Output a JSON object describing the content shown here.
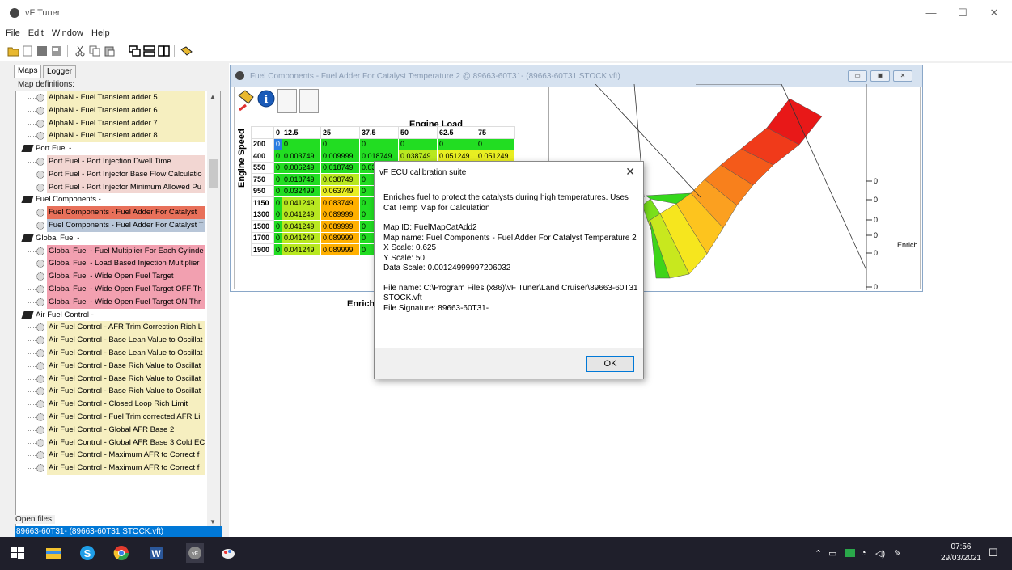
{
  "app": {
    "title": "vF Tuner"
  },
  "window_controls": {
    "minimize": "—",
    "maximize": "☐",
    "close": "✕"
  },
  "menu": [
    "File",
    "Edit",
    "Window",
    "Help"
  ],
  "left_panel": {
    "tabs": [
      "Maps",
      "Logger"
    ],
    "map_definitions_label": "Map definitions:",
    "open_files_label": "Open files:",
    "open_file": "89663-60T31- (89663-60T31 STOCK.vft)",
    "tree": [
      {
        "label": "AlphaN - Fuel Transient adder 5",
        "type": "map",
        "color": "#f6efc0"
      },
      {
        "label": "AlphaN - Fuel Transient adder 6",
        "type": "map",
        "color": "#f6efc0"
      },
      {
        "label": "AlphaN - Fuel Transient adder 7",
        "type": "map",
        "color": "#f6efc0"
      },
      {
        "label": "AlphaN - Fuel Transient adder 8",
        "type": "map",
        "color": "#f6efc0"
      },
      {
        "label": "Port Fuel -",
        "type": "cat",
        "color": "#ffffff"
      },
      {
        "label": "Port Fuel - Port Injection Dwell Time",
        "type": "map",
        "color": "#f2d6d2"
      },
      {
        "label": "Port Fuel - Port Injector Base Flow Calculatio",
        "type": "map",
        "color": "#f2d6d2"
      },
      {
        "label": "Port Fuel - Port Injector Minimum Allowed Pu",
        "type": "map",
        "color": "#f2d6d2"
      },
      {
        "label": "Fuel Components -",
        "type": "cat",
        "color": "#ffffff"
      },
      {
        "label": "Fuel Components - Fuel Adder For Catalyst",
        "type": "map",
        "color": "#e8705a"
      },
      {
        "label": "Fuel Components - Fuel Adder For Catalyst T",
        "type": "map",
        "color": "#b8c6d8"
      },
      {
        "label": "Global Fuel -",
        "type": "cat",
        "color": "#ffffff"
      },
      {
        "label": "Global Fuel - Fuel Multiplier For Each Cylinde",
        "type": "map",
        "color": "#f2a0b0"
      },
      {
        "label": "Global Fuel - Load Based Injection Multiplier",
        "type": "map",
        "color": "#f2a0b0"
      },
      {
        "label": "Global Fuel - Wide Open Fuel Target",
        "type": "map",
        "color": "#f2a0b0"
      },
      {
        "label": "Global Fuel - Wide Open Fuel Target OFF Th",
        "type": "map",
        "color": "#f2a0b0"
      },
      {
        "label": "Global Fuel - Wide Open Fuel Target ON Thr",
        "type": "map",
        "color": "#f2a0b0"
      },
      {
        "label": "Air Fuel Control -",
        "type": "cat",
        "color": "#ffffff"
      },
      {
        "label": "Air Fuel Control - AFR Trim Correction Rich L",
        "type": "map",
        "color": "#f6efc0"
      },
      {
        "label": "Air Fuel Control - Base Lean Value to Oscillat",
        "type": "map",
        "color": "#f6efc0"
      },
      {
        "label": "Air Fuel Control - Base Lean Value to Oscillat",
        "type": "map",
        "color": "#f6efc0"
      },
      {
        "label": "Air Fuel Control - Base Rich Value to Oscillat",
        "type": "map",
        "color": "#f6efc0"
      },
      {
        "label": "Air Fuel Control - Base Rich Value to Oscillat",
        "type": "map",
        "color": "#f6efc0"
      },
      {
        "label": "Air Fuel Control - Base Rich Value to Oscillat",
        "type": "map",
        "color": "#f6efc0"
      },
      {
        "label": "Air Fuel Control - Closed Loop Rich Limit",
        "type": "map",
        "color": "#f6efc0"
      },
      {
        "label": "Air Fuel Control - Fuel Trim corrected AFR Li",
        "type": "map",
        "color": "#f6efc0"
      },
      {
        "label": "Air Fuel Control - Global AFR Base 2",
        "type": "map",
        "color": "#f6efc0"
      },
      {
        "label": "Air Fuel Control - Global AFR Base 3 Cold EC",
        "type": "map",
        "color": "#f6efc0"
      },
      {
        "label": "Air Fuel Control - Maximum AFR to Correct f",
        "type": "map",
        "color": "#f6efc0"
      },
      {
        "label": "Air Fuel Control - Maximum AFR to Correct f",
        "type": "map",
        "color": "#f6efc0"
      }
    ]
  },
  "map_window": {
    "title": "Fuel Components - Fuel Adder For Catalyst Temperature 2 @ 89663-60T31- (89663-60T31 STOCK.vft)",
    "x_axis_label": "Engine Load",
    "y_axis_label": "Engine Speed",
    "z_label": "Enrich",
    "chart_z_label": "Enrich",
    "chart_z_ticks": [
      "0",
      "0",
      "0",
      "0",
      "0",
      "0"
    ],
    "columns": [
      "0",
      "12.5",
      "25",
      "37.5",
      "50",
      "62.5",
      "75"
    ],
    "rows": [
      {
        "rpm": "200",
        "cells": [
          "0",
          "0",
          "0",
          "0",
          "0",
          "0",
          "0"
        ]
      },
      {
        "rpm": "400",
        "cells": [
          "0",
          "0.003749",
          "0.009999",
          "0.018749",
          "0.038749",
          "0.051249",
          "0.051249"
        ]
      },
      {
        "rpm": "550",
        "cells": [
          "0",
          "0.006249",
          "0.018749",
          "0.034999",
          "0.079999",
          "0.098749",
          "0.121249"
        ]
      },
      {
        "rpm": "750",
        "cells": [
          "0",
          "0.018749",
          "0.038749",
          "0",
          "",
          "",
          ""
        ]
      },
      {
        "rpm": "950",
        "cells": [
          "0",
          "0.032499",
          "0.063749",
          "0",
          "",
          "",
          ""
        ]
      },
      {
        "rpm": "1150",
        "cells": [
          "0",
          "0.041249",
          "0.083749",
          "0",
          "",
          "",
          ""
        ]
      },
      {
        "rpm": "1300",
        "cells": [
          "0",
          "0.041249",
          "0.089999",
          "0",
          "",
          "",
          ""
        ]
      },
      {
        "rpm": "1500",
        "cells": [
          "0",
          "0.041249",
          "0.089999",
          "0",
          "",
          "",
          ""
        ]
      },
      {
        "rpm": "1700",
        "cells": [
          "0",
          "0.041249",
          "0.089999",
          "0",
          "",
          "",
          ""
        ]
      },
      {
        "rpm": "1900",
        "cells": [
          "0",
          "0.041249",
          "0.089999",
          "0",
          "",
          "",
          ""
        ]
      }
    ]
  },
  "dialog": {
    "title": "vF ECU calibration suite",
    "description": "Enriches fuel to protect the catalysts during high temperatures. Uses Cat Temp Map for Calculation",
    "map_id": "Map ID: FuelMapCatAdd2",
    "map_name": "Map name: Fuel Components - Fuel Adder For Catalyst Temperature 2",
    "x_scale": "X Scale: 0.625",
    "y_scale": "Y Scale: 50",
    "data_scale": "Data Scale: 0.00124999997206032",
    "file_name": "File name: C:\\Program Files (x86)\\vF Tuner\\Land Cruiser\\89663-60T31 STOCK.vft",
    "file_signature": "File Signature: 89663-60T31-",
    "ok_label": "OK",
    "close_label": "✕"
  },
  "taskbar": {
    "time": "07:56",
    "date": "29/03/2021"
  },
  "colors": {
    "green": "#22dd22",
    "yellow": "#e8ee22",
    "orange": "#ffb000",
    "selection": "#0078d7"
  }
}
